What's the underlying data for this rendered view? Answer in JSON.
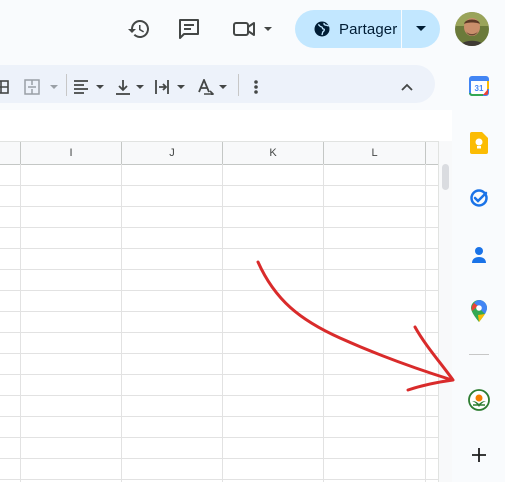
{
  "header": {
    "share_label": "Partager",
    "icons": [
      "history-icon",
      "comment-icon",
      "video-call-icon",
      "globe-icon",
      "dropdown-icon"
    ]
  },
  "toolbar": {
    "icons": [
      "table-border-icon",
      "merge-cells-icon",
      "horizontal-align-icon",
      "vertical-align-icon",
      "text-wrap-icon",
      "text-rotation-icon",
      "more-options-icon",
      "collapse-toolbar-icon"
    ]
  },
  "grid": {
    "columns": [
      "I",
      "J",
      "K",
      "L"
    ]
  },
  "side_panel": {
    "apps": [
      "Calendar",
      "Keep",
      "Tasks",
      "Contacts",
      "Maps",
      "Add-on",
      "Get add-ons"
    ]
  },
  "colors": {
    "share_bg": "#c2e7ff",
    "toolbar_bg": "#edf2fa",
    "annotation_arrow": "#d92b2b"
  }
}
